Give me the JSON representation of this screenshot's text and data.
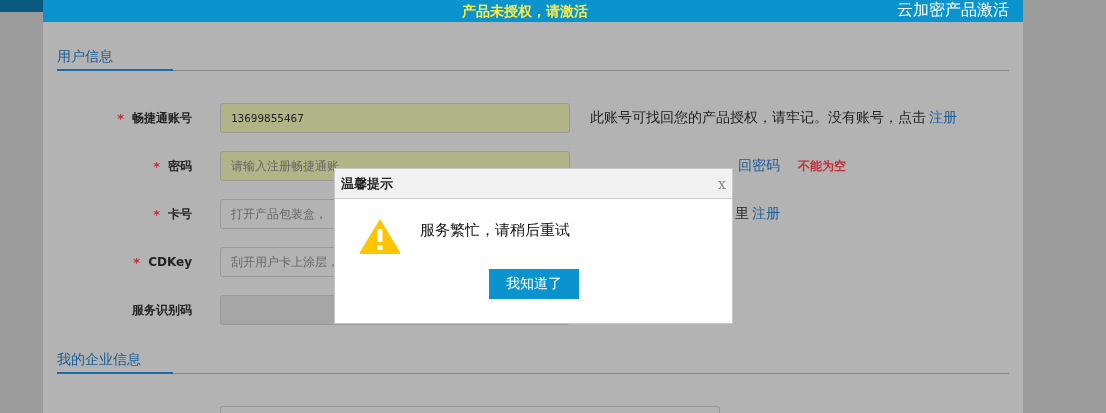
{
  "header": {
    "notice": "产品未授权，请激活",
    "title": "云加密产品激活"
  },
  "sections": [
    {
      "title": "用户信息",
      "rows": [
        {
          "mark": "*",
          "label": "畅捷通账号",
          "value": "13699855467",
          "highlighted": true,
          "disabled": false,
          "hint": [
            {
              "kind": "text",
              "text": "此账号可找回您的产品授权，请牢记。没有账号，点击"
            },
            {
              "kind": "link",
              "text": "注册"
            }
          ]
        },
        {
          "mark": "*",
          "label": "密码",
          "placeholder": "请输入注册畅捷通账",
          "highlighted": true,
          "disabled": false,
          "hint": [
            {
              "kind": "link",
              "text": "回密码"
            },
            {
              "kind": "error",
              "text": "不能为空"
            }
          ]
        },
        {
          "mark": "*",
          "label": "卡号",
          "placeholder": "打开产品包装盒，",
          "highlighted": false,
          "disabled": false,
          "hint": [
            {
              "kind": "text",
              "text": "里"
            },
            {
              "kind": "link",
              "text": "注册"
            }
          ]
        },
        {
          "mark": "*",
          "label": "CDKey",
          "placeholder": "刮开用户卡上涂层，",
          "highlighted": false,
          "disabled": false,
          "hint": []
        },
        {
          "label": "服务识别码",
          "highlighted": false,
          "disabled": true,
          "hint": []
        }
      ]
    },
    {
      "title": "我的企业信息",
      "rows": [
        {
          "highlighted": false,
          "disabled": false,
          "hint": []
        }
      ]
    }
  ],
  "dialog": {
    "title": "温馨提示",
    "close": "x",
    "message": "服务繁忙，请稍后重试",
    "button": "我知道了"
  }
}
